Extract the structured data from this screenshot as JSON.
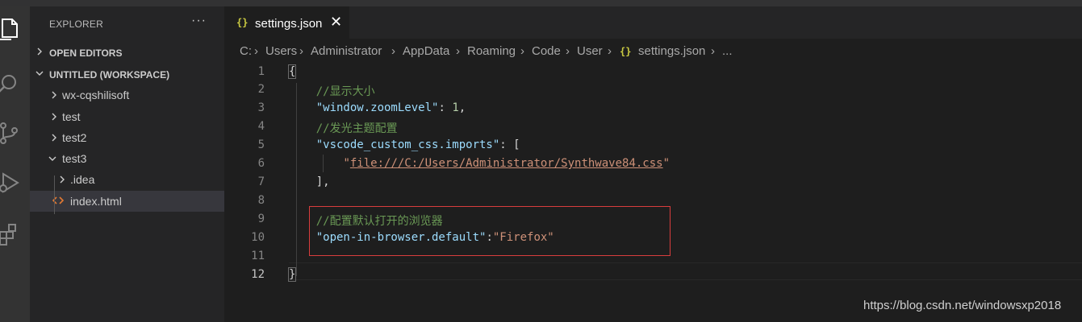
{
  "activity_bar": {
    "icons": [
      "files-icon",
      "search-icon",
      "source-control-icon",
      "run-debug-icon",
      "extensions-icon"
    ]
  },
  "sidebar": {
    "title": "EXPLORER",
    "more": "···",
    "sections": {
      "open_editors": "OPEN EDITORS",
      "workspace": "UNTITLED (WORKSPACE)"
    },
    "tree": [
      {
        "label": "wx-cqshilisoft",
        "expanded": false
      },
      {
        "label": "test",
        "expanded": false
      },
      {
        "label": "test2",
        "expanded": false
      },
      {
        "label": "test3",
        "expanded": true
      },
      {
        "label": ".idea",
        "expanded": false
      },
      {
        "label": "index.html",
        "selected": true
      }
    ]
  },
  "tab": {
    "icon": "{}",
    "label": "settings.json",
    "close": "✕"
  },
  "breadcrumb": {
    "parts": [
      "C:",
      "Users",
      "Administrator",
      "AppData",
      "Roaming",
      "Code",
      "User",
      "settings.json",
      "..."
    ],
    "file_icon": "{}"
  },
  "editor": {
    "line_numbers": [
      "1",
      "2",
      "3",
      "4",
      "5",
      "6",
      "7",
      "8",
      "9",
      "10",
      "11",
      "12"
    ],
    "lines": [
      "{",
      "    //显示大小",
      "    \"window.zoomLevel\": 1,",
      "    //发光主题配置",
      "    \"vscode_custom_css.imports\": [",
      "        \"file:///C:/Users/Administrator/Synthwave84.css\"",
      "    ],",
      "",
      "    //配置默认打开的浏览器",
      "    \"open-in-browser.default\":\"Firefox\"",
      "",
      "}"
    ],
    "active_line": 12
  },
  "colors": {
    "comment": "#6a9955",
    "key": "#9cdcfe",
    "string": "#ce9178",
    "number": "#b5cea8",
    "highlight_box": "#d93d3d"
  },
  "watermark": "https://blog.csdn.net/windowsxp2018"
}
